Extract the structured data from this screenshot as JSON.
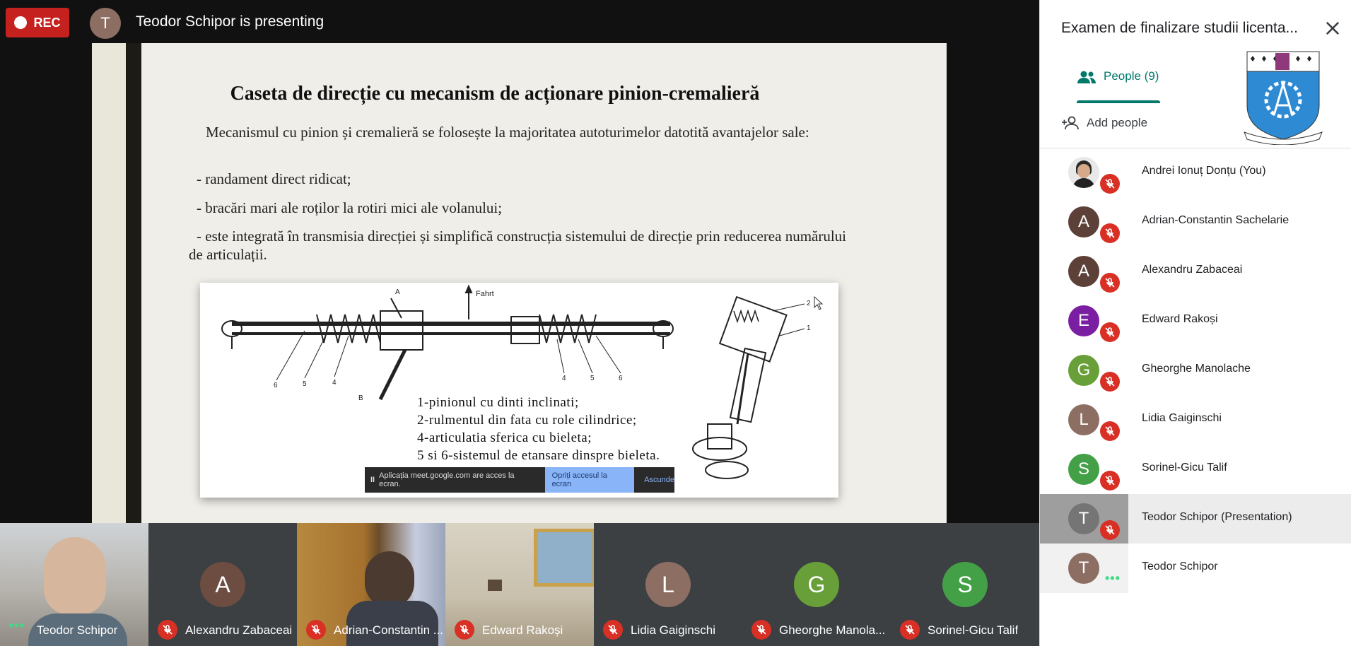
{
  "header": {
    "rec_label": "REC",
    "presenter_initial": "T",
    "presenting_text": "Teodor Schipor is presenting"
  },
  "slide": {
    "title": "Caseta de direcție cu mecanism de acționare pinion-cremalieră",
    "intro": "Mecanismul cu pinion și cremalieră se folosește la majoritatea autoturimelor datotită avantajelor sale:",
    "bullets": [
      "- randament direct ridicat;",
      "- bracări mari ale roților la rotiri mici ale volanului;",
      "- este integrată în transmisia direcției și simplifică construcția sistemului de direcție prin reducerea numărului de articulații."
    ],
    "figure": {
      "arrow_label": "Fahrt",
      "part_numbers": [
        "6",
        "5",
        "4",
        "4",
        "5",
        "6",
        "2",
        "1",
        "A",
        "B"
      ],
      "legend": [
        "1-pinionul  cu  dinti  inclinati;",
        "2-rulmentul  din  fata  cu  role  cilindrice;",
        "4-articulatia  sferica  cu  bieleta;",
        "5 si 6-sistemul de etansare dinspre bieleta."
      ]
    }
  },
  "share_bar": {
    "message": "Aplicația meet.google.com are acces la ecran.",
    "stop_label": "Opriți accesul la ecran",
    "hide_label": "Ascunde"
  },
  "filmstrip": [
    {
      "name": "Teodor Schipor",
      "initial": "",
      "avatar_color": "",
      "muted": false,
      "video": true
    },
    {
      "name": "Alexandru Zabaceai",
      "initial": "A",
      "avatar_color": "#6d4c41",
      "muted": true,
      "video": false
    },
    {
      "name": "Adrian-Constantin ...",
      "initial": "",
      "avatar_color": "",
      "muted": true,
      "video": true
    },
    {
      "name": "Edward Rakoși",
      "initial": "",
      "avatar_color": "",
      "muted": true,
      "video": true
    },
    {
      "name": "Lidia Gaiginschi",
      "initial": "L",
      "avatar_color": "#8d6e63",
      "muted": true,
      "video": false
    },
    {
      "name": "Gheorghe Manola...",
      "initial": "G",
      "avatar_color": "#689f38",
      "muted": true,
      "video": false
    },
    {
      "name": "Sorinel-Gicu Talif",
      "initial": "S",
      "avatar_color": "#43a047",
      "muted": true,
      "video": false
    }
  ],
  "panel": {
    "title": "Examen de finalizare studii licenta...",
    "tab_label": "People (9)",
    "add_people_label": "Add people",
    "people": [
      {
        "name": "Andrei Ionuț Donțu (You)",
        "initial": "",
        "avatar_color": "#37474f",
        "muted": true
      },
      {
        "name": "Adrian-Constantin Sachelarie",
        "initial": "A",
        "avatar_color": "#5d4037",
        "muted": true
      },
      {
        "name": "Alexandru Zabaceai",
        "initial": "A",
        "avatar_color": "#5d4037",
        "muted": true
      },
      {
        "name": "Edward Rakoși",
        "initial": "E",
        "avatar_color": "#7b1fa2",
        "muted": true
      },
      {
        "name": "Gheorghe Manolache",
        "initial": "G",
        "avatar_color": "#689f38",
        "muted": true
      },
      {
        "name": "Lidia Gaiginschi",
        "initial": "L",
        "avatar_color": "#8d6e63",
        "muted": true
      },
      {
        "name": "Sorinel-Gicu Talif",
        "initial": "S",
        "avatar_color": "#43a047",
        "muted": true
      },
      {
        "name": "Teodor Schipor (Presentation)",
        "initial": "T",
        "avatar_color": "#757575",
        "muted": true
      },
      {
        "name": "Teodor Schipor",
        "initial": "T",
        "avatar_color": "#8d6e63",
        "muted": false
      }
    ]
  },
  "colors": {
    "rec_red": "#c5221f",
    "mic_off_red": "#d93025",
    "accent_teal": "#00796b",
    "speaking_green": "#3ddc84"
  }
}
